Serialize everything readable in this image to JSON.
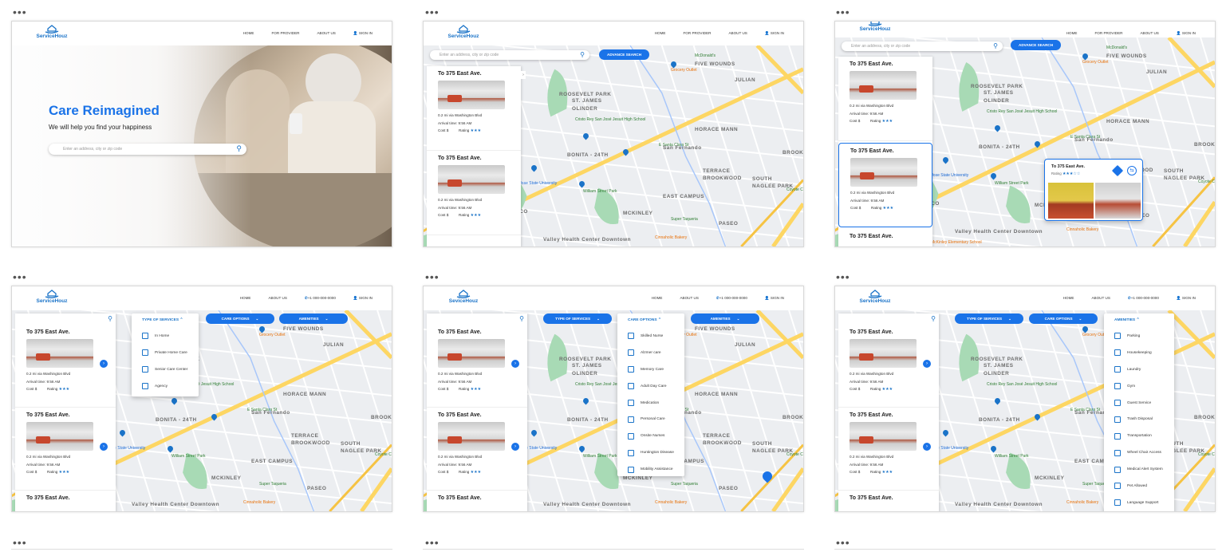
{
  "brand": "ServiceHouz",
  "brand_alt": "SeviceHouz",
  "nav_v1": [
    "HOME",
    "FOR PROVIDER",
    "ABOUT US",
    "SIGN IN"
  ],
  "nav_v2": [
    "HOME",
    "ABOUT US",
    "+1 000-000-0000",
    "SIGN IN"
  ],
  "hero": {
    "title": "Care Reimagined",
    "subtitle": "We will help you find your happiness",
    "placeholder": "Enter an address, city or zip code"
  },
  "search_placeholder": "Enter an address, city or zip code",
  "advance_search": "ADVANCE SEARCH",
  "card": {
    "title": "To 375 East Ave.",
    "distance": "0.2 mi via Washington Blvd",
    "arrival": "Arrival time: 9:56 AM",
    "cost": "Cost $",
    "rating": "Rating"
  },
  "popup": {
    "title": "To 375 East Ave.",
    "rating": "Rating"
  },
  "filters": {
    "type": "TYPE OF SERVICES",
    "care": "CARE OPTIONS",
    "amenities": "AMENITIES"
  },
  "type_options": [
    "In Home",
    "Private Home Care",
    "Senior Care Center",
    "Agency"
  ],
  "care_options": [
    "Skilled Nurse",
    "Alzmer care",
    "Memory Care",
    "Adult Day Care",
    "Medication",
    "Personal Care",
    "Onsite Nurses",
    "Huntington Disease",
    "Mobility Assistance"
  ],
  "amenity_options": [
    "Parking",
    "Housekeeping",
    "Laundry",
    "Gym",
    "Guest Service",
    "Trash Disposal",
    "Transportation",
    "Wheel Chair Access",
    "Medical Alert System",
    "Pet Allowed",
    "Language Support"
  ],
  "map_labels": [
    "ROOSEVELT PARK",
    "FIVE WOUNDS",
    "JULIAN",
    "ST. JAMES",
    "OLINDER",
    "HORACE MANN",
    "BONITA - 24TH",
    "BROOKWOOD",
    "TERRACE",
    "BROOKWOOD",
    "SOUTH",
    "NAGLEE PARK",
    "EAST CAMPUS",
    "MCKINLEY",
    "PASEO",
    "Valley Health Center Downtown",
    "Cristo Rey San José Jesuit High School",
    "McDonald's",
    "Grocery Outlet",
    "San Jose State University",
    "William Street Park",
    "Super Taqueria",
    "Cinnaholic Bakery",
    "McKinley Elementary School",
    "Coyote Creek",
    "E Santa Clara St",
    "San Fernando",
    "ARCO"
  ]
}
